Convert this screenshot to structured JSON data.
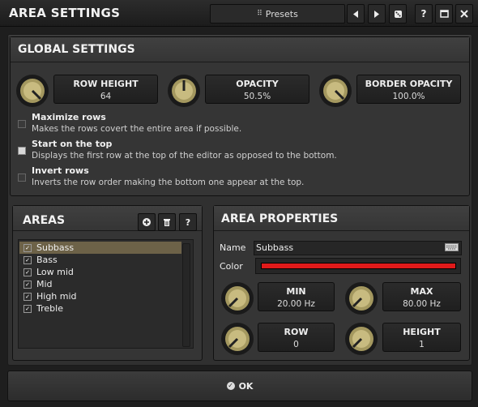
{
  "window": {
    "title": "AREA SETTINGS",
    "presets_label": "Presets"
  },
  "global": {
    "header": "GLOBAL SETTINGS",
    "knobs": [
      {
        "label": "ROW HEIGHT",
        "value": "64"
      },
      {
        "label": "OPACITY",
        "value": "50.5%"
      },
      {
        "label": "BORDER OPACITY",
        "value": "100.0%"
      }
    ],
    "options": [
      {
        "title": "Maximize rows",
        "desc": "Makes the rows covert the entire area if possible.",
        "checked": false
      },
      {
        "title": "Start on the top",
        "desc": "Displays the first row at the top of the editor as opposed to the bottom.",
        "checked": true
      },
      {
        "title": "Invert rows",
        "desc": "Inverts the row order making the bottom one appear at the top.",
        "checked": false
      }
    ]
  },
  "areas": {
    "header": "AREAS",
    "items": [
      "Subbass",
      "Bass",
      "Low mid",
      "Mid",
      "High mid",
      "Treble"
    ],
    "selected": "Subbass"
  },
  "props": {
    "header": "AREA PROPERTIES",
    "name_label": "Name",
    "name_value": "Subbass",
    "color_label": "Color",
    "color_value": "#e01a1a",
    "knobs": [
      {
        "label": "MIN",
        "value": "20.00 Hz"
      },
      {
        "label": "MAX",
        "value": "80.00 Hz"
      },
      {
        "label": "ROW",
        "value": "0"
      },
      {
        "label": "HEIGHT",
        "value": "1"
      }
    ]
  },
  "footer": {
    "ok_label": "OK"
  },
  "icons": {
    "check": "✓",
    "add": "+",
    "help": "?"
  }
}
